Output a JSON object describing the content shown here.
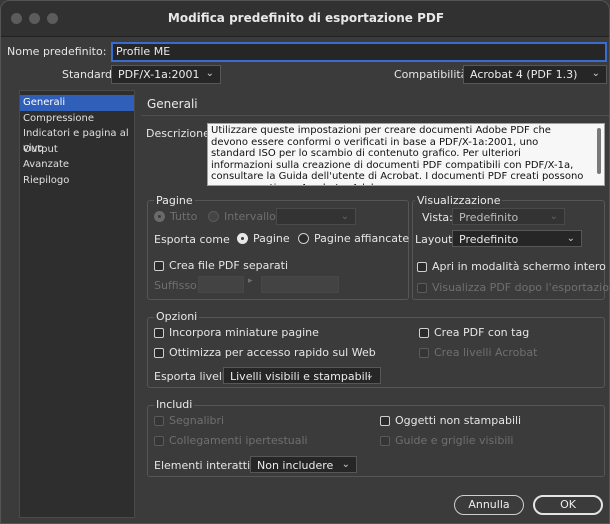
{
  "window": {
    "title": "Modifica predefinito di esportazione PDF"
  },
  "preset": {
    "name_label": "Nome predefinito:",
    "name_value": "Profile ME"
  },
  "standard": {
    "label": "Standard:",
    "value": "PDF/X-1a:2001"
  },
  "compat": {
    "label": "Compatibilità:",
    "value": "Acrobat 4 (PDF 1.3)"
  },
  "sidebar": {
    "items": [
      {
        "label": "Generali",
        "selected": true
      },
      {
        "label": "Compressione"
      },
      {
        "label": "Indicatori e pagina al vivo"
      },
      {
        "label": "Output"
      },
      {
        "label": "Avanzate"
      },
      {
        "label": "Riepilogo"
      }
    ]
  },
  "main": {
    "header": "Generali",
    "desc_label": "Descrizione:",
    "description": "Utilizzare queste impostazioni per creare documenti Adobe PDF che devono essere conformi o verificati in base a PDF/X-1a:2001, uno standard ISO per lo scambio di contenuto grafico. Per ulteriori informazioni sulla creazione di documenti PDF compatibili con PDF/X-1a, consultare la Guida dell'utente di Acrobat. I documenti PDF creati possono essere aperti con Acrobat e Adobe"
  },
  "pagine": {
    "title": "Pagine",
    "tutto": "Tutto",
    "intervallo": "Intervallo:",
    "esporta_come": "Esporta come",
    "opt_pagine": "Pagine",
    "opt_affiancate": "Pagine affiancate",
    "crea_separati": "Crea file PDF separati",
    "suffisso": "Suffisso:"
  },
  "visual": {
    "title": "Visualizzazione",
    "vista_label": "Vista:",
    "vista_value": "Predefinito",
    "layout_label": "Layout:",
    "layout_value": "Predefinito",
    "schermo_intero": "Apri in modalità schermo intero",
    "dopo_esportazione": "Visualizza PDF dopo l'esportazione"
  },
  "opzioni": {
    "title": "Opzioni",
    "miniature": "Incorpora miniature pagine",
    "ottimizza": "Ottimizza per accesso rapido sul Web",
    "con_tag": "Crea PDF con tag",
    "livelli_acrobat": "Crea livelli Acrobat",
    "esporta_livelli_label": "Esporta livelli:",
    "esporta_livelli_value": "Livelli visibili e stampabili"
  },
  "includi": {
    "title": "Includi",
    "segnalibri": "Segnalibri",
    "collegamenti": "Collegamenti ipertestuali",
    "oggetti": "Oggetti non stampabili",
    "guide": "Guide e griglie visibili",
    "elementi_label": "Elementi interattivi:",
    "elementi_value": "Non includere"
  },
  "buttons": {
    "cancel": "Annulla",
    "ok": "OK"
  },
  "colors": {
    "accent": "#2f5fb8",
    "focus": "#3a6bd1",
    "bg": "#3b3b3b"
  }
}
